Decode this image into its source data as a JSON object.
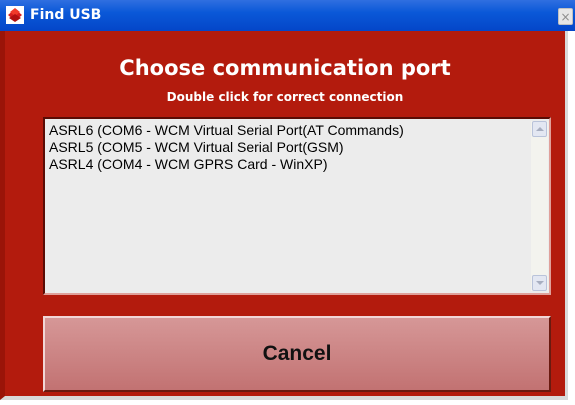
{
  "window": {
    "title": "Find USB",
    "close_glyph": "×"
  },
  "dialog": {
    "heading": "Choose communication port",
    "subheading": "Double click for correct connection"
  },
  "port_list": {
    "items": [
      "ASRL6  (COM6 - WCM Virtual Serial Port(AT Commands)",
      "ASRL5  (COM5 - WCM Virtual Serial Port(GSM)",
      "ASRL4  (COM4 - WCM GPRS Card - WinXP)"
    ]
  },
  "buttons": {
    "cancel_label": "Cancel"
  },
  "icons": {
    "app": "app-logo-icon",
    "close": "close-icon",
    "scroll_up": "scroll-up-icon",
    "scroll_down": "scroll-down-icon"
  },
  "colors": {
    "titlebar": "#0a58d8",
    "panel": "#b31b0d",
    "button": "#cb8383",
    "list_bg": "#ececec"
  }
}
